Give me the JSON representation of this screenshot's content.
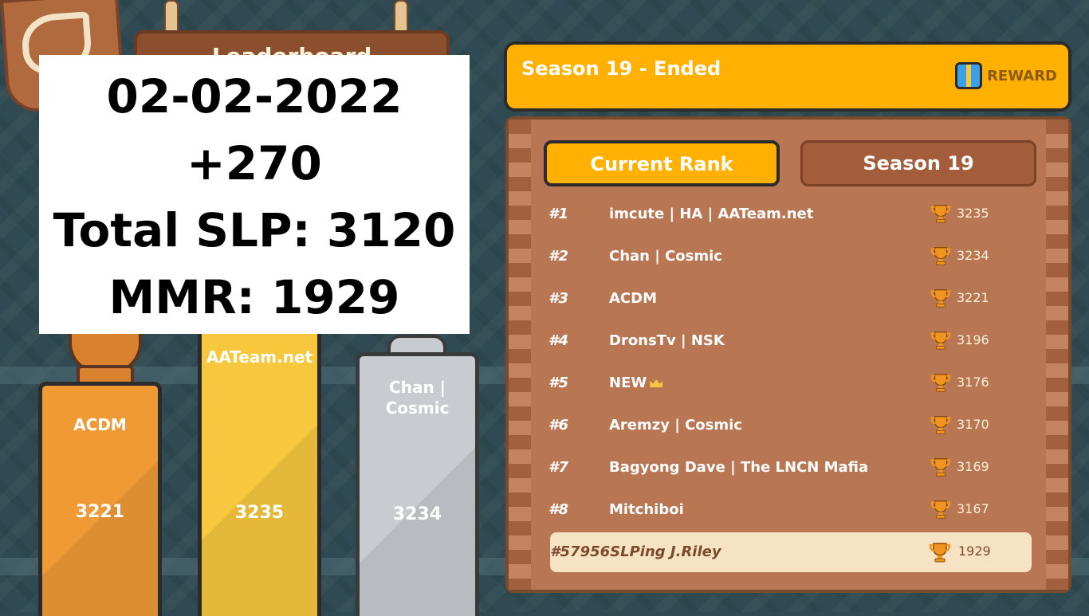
{
  "overlay": {
    "date": "02-02-2022",
    "change": "+270",
    "total_slp": "Total SLP: 3120",
    "mmr": "MMR: 1929"
  },
  "sign": {
    "title": "Leaderboard"
  },
  "podium": [
    {
      "place": 3,
      "name": "ACDM",
      "score": "3221"
    },
    {
      "place": 1,
      "name": "imcute | HA | AATeam.net",
      "name_visible": "AATeam.net",
      "score": "3235"
    },
    {
      "place": 2,
      "name": "Chan | Cosmic",
      "score": "3234"
    }
  ],
  "season": {
    "title": "Season 19 - Ended",
    "reward_label": "REWARD"
  },
  "tabs": [
    {
      "label": "Current Rank",
      "active": true
    },
    {
      "label": "Season 19",
      "active": false
    }
  ],
  "ranks": [
    {
      "rank": "#1",
      "name": "imcute | HA | AATeam.net",
      "score": "3235"
    },
    {
      "rank": "#2",
      "name": "Chan | Cosmic",
      "score": "3234"
    },
    {
      "rank": "#3",
      "name": "ACDM",
      "score": "3221"
    },
    {
      "rank": "#4",
      "name": "DronsTv | NSK",
      "score": "3196"
    },
    {
      "rank": "#5",
      "name": "NEW",
      "score": "3176",
      "crown": true
    },
    {
      "rank": "#6",
      "name": "Aremzy | Cosmic",
      "score": "3170"
    },
    {
      "rank": "#7",
      "name": "Bagyong Dave | The LNCN Mafia",
      "score": "3169"
    },
    {
      "rank": "#8",
      "name": "Mitchiboi",
      "score": "3167"
    }
  ],
  "me": {
    "label": "#57956SLPing J.Riley",
    "score": "1929"
  },
  "colors": {
    "background": "#2f4a52",
    "banner": "#ffb000",
    "board": "#b87653",
    "gold_pillar": "#f7c83e",
    "orange_pillar": "#f09a35",
    "silver_pillar": "#c8ccd1"
  },
  "icons": [
    "gift-icon",
    "trophy-icon",
    "crown-icon"
  ]
}
